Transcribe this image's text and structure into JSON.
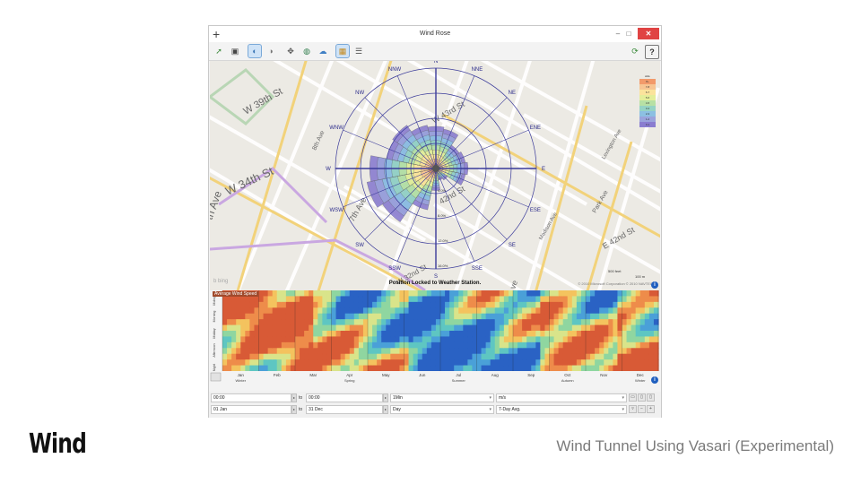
{
  "slide": {
    "title": "Wind",
    "subtitle": "Wind Tunnel Using Vasari (Experimental)"
  },
  "window": {
    "title": "Wind Rose",
    "plus_glyph": "+",
    "min_glyph": "–",
    "max_glyph": "□",
    "close_glyph": "✕"
  },
  "toolbar": {
    "buttons": [
      {
        "name": "export-icon",
        "glyph": "➚",
        "selected": false
      },
      {
        "name": "save-icon",
        "glyph": "▣",
        "selected": false
      },
      {
        "name": "map-view-icon",
        "glyph": "◐",
        "selected": true
      },
      {
        "name": "3d-view-icon",
        "glyph": "◑",
        "selected": false
      },
      {
        "name": "pan-icon",
        "glyph": "✥",
        "selected": false
      },
      {
        "name": "globe-icon",
        "glyph": "◍",
        "selected": false
      },
      {
        "name": "weather-station-icon",
        "glyph": "☁",
        "selected": false
      },
      {
        "name": "chart-icon",
        "glyph": "▦",
        "selected": true
      },
      {
        "name": "list-icon",
        "glyph": "☰",
        "selected": false
      }
    ],
    "right_buttons": [
      {
        "name": "refresh-icon",
        "glyph": "⟳"
      },
      {
        "name": "help-icon",
        "glyph": "?"
      }
    ]
  },
  "map": {
    "lock_message": "Position Locked to Weather Station.",
    "bing_logo": "b bing",
    "copyright": "© 2010 Microsoft Corporation   © 2010 NAVTEQ",
    "scale": [
      "500 feet",
      "100 m"
    ],
    "street_labels": [
      {
        "text": "W 39th St"
      },
      {
        "text": "W 34th St"
      },
      {
        "text": "8th Ave"
      },
      {
        "text": "7th Ave"
      },
      {
        "text": "W 43rd St"
      },
      {
        "text": "42nd St"
      },
      {
        "text": "E 42nd St"
      },
      {
        "text": "Park Ave"
      },
      {
        "text": "th Ave"
      },
      {
        "text": "Lexington Ave"
      },
      {
        "text": "Madison Ave"
      },
      {
        "text": "W 32nd St"
      },
      {
        "text": "ve"
      }
    ],
    "directions": [
      "N",
      "NNE",
      "NE",
      "ENE",
      "E",
      "ESE",
      "SE",
      "SSE",
      "S",
      "SSW",
      "SW",
      "WSW",
      "W",
      "WNW",
      "NW",
      "NNW"
    ],
    "rose_sectors": [
      0.42,
      0.4,
      0.28,
      0.3,
      0.32,
      0.3,
      0.14,
      0.12,
      0.22,
      0.42,
      0.64,
      0.7,
      0.66,
      0.5,
      0.52,
      0.44
    ],
    "rose_pct_labels": [
      "4.0%",
      "8.0%",
      "12.0%",
      "16.0%"
    ],
    "legend": {
      "title": "m/s",
      "items": [
        {
          "label": "8+",
          "color": "#f29a6b"
        },
        {
          "label": "7-8",
          "color": "#f7c593"
        },
        {
          "label": "6-7",
          "color": "#fbe39c"
        },
        {
          "label": "5-6",
          "color": "#e4ee9a"
        },
        {
          "label": "4-5",
          "color": "#b7e0a4"
        },
        {
          "label": "3-4",
          "color": "#95d3c4"
        },
        {
          "label": "2-3",
          "color": "#8cc0e2"
        },
        {
          "label": "1-2",
          "color": "#9aa3dc"
        },
        {
          "label": "0-1",
          "color": "#8a7dd0"
        }
      ]
    },
    "info_glyph": "i"
  },
  "heatmap": {
    "label": "Average Wind Speed",
    "months": [
      "Jan",
      "Feb",
      "Mar",
      "Apr",
      "May",
      "Jun",
      "Jul",
      "Aug",
      "Sep",
      "Oct",
      "Nov",
      "Dec"
    ],
    "seasons": [
      "Winter",
      "Spring",
      "Summer",
      "Autumn",
      "Winter"
    ],
    "y_labels": [
      "Midnight",
      "Morning",
      "Midday",
      "Afternoon",
      "Night"
    ],
    "info_glyph": "i"
  },
  "controls": {
    "time_from": "00:00",
    "time_to": "00:00",
    "to_label": "to",
    "date_from": "01 Jan",
    "date_to": "31 Dec",
    "interval": "1Min",
    "period": "Day",
    "units": "m/s",
    "average": "7-Day Avg.",
    "dropdown_glyph": "▾",
    "spin_glyph": "▸"
  }
}
